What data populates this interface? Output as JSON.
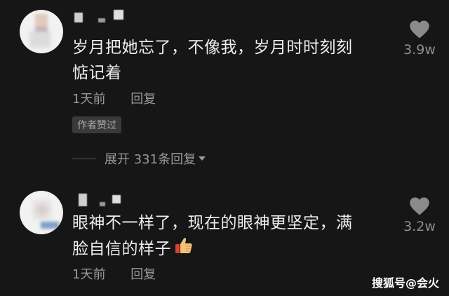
{
  "comments": [
    {
      "text_line1": "岁月把她忘了，不像我，岁月时时刻刻",
      "text_line2": "惦记着",
      "time": "1天前",
      "reply_label": "回复",
      "badge": "作者赞过",
      "like_count": "3.9w"
    },
    {
      "text_line1": "眼神不一样了，现在的眼神更坚定，满",
      "text_line2": "脸自信的样子",
      "time": "1天前",
      "reply_label": "回复",
      "like_count": "3.2w"
    }
  ],
  "expand_replies": "展开 331条回复",
  "watermark": "搜狐号@会火",
  "colors": {
    "background": "#161616",
    "text": "#eeeeee",
    "meta": "#9a9a9a",
    "badge_bg": "#3a3a3a"
  },
  "icons": [
    "heart-icon",
    "thumbs-up-emoji",
    "caret-down-icon"
  ]
}
